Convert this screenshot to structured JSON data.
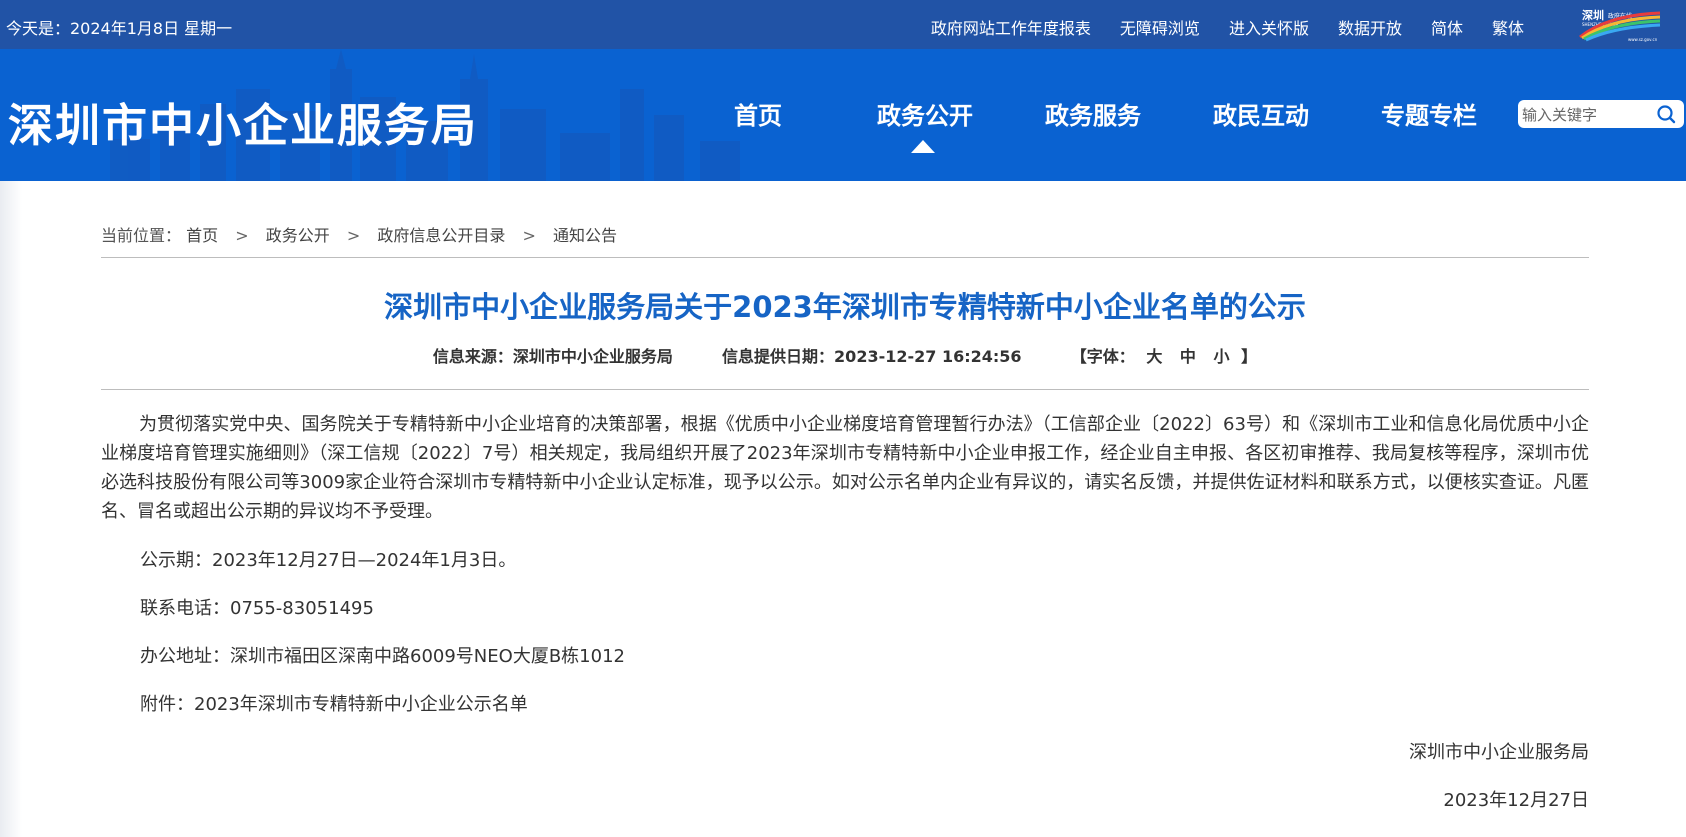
{
  "topbar": {
    "date": "今天是：2024年1月8日 星期一",
    "links": [
      "政府网站工作年度报表",
      "无障碍浏览",
      "进入关怀版",
      "数据开放",
      "简体",
      "繁体"
    ],
    "logo_text": "深圳 政府在线"
  },
  "header": {
    "site_title": "深圳市中小企业服务局",
    "nav": [
      "首页",
      "政务公开",
      "政务服务",
      "政民互动",
      "专题专栏"
    ],
    "active_nav": "政务公开",
    "search_placeholder": "输入关键字"
  },
  "breadcrumb": {
    "prefix": "当前位置：",
    "items": [
      "首页",
      "政务公开",
      "政府信息公开目录",
      "通知公告"
    ],
    "separator": ">"
  },
  "article": {
    "title": "深圳市中小企业服务局关于2023年深圳市专精特新中小企业名单的公示",
    "source": "信息来源：深圳市中小企业服务局",
    "date": "信息提供日期：2023-12-27 16:24:56",
    "font_label": "【字体：",
    "font_large": "大",
    "font_medium": "中",
    "font_small": "小",
    "font_close": "】",
    "paragraph": "为贯彻落实党中央、国务院关于专精特新中小企业培育的决策部署，根据《优质中小企业梯度培育管理暂行办法》（工信部企业〔2022〕63号）和《深圳市工业和信息化局优质中小企业梯度培育管理实施细则》（深工信规〔2022〕7号）相关规定，我局组织开展了2023年深圳市专精特新中小企业申报工作，经企业自主申报、各区初审推荐、我局复核等程序，深圳市优必选科技股份有限公司等3009家企业符合深圳市专精特新中小企业认定标准，现予以公示。如对公示名单内企业有异议的，请实名反馈，并提供佐证材料和联系方式，以便核实查证。凡匿名、冒名或超出公示期的异议均不予受理。",
    "period": "公示期：2023年12月27日—2024年1月3日。",
    "phone": "联系电话：0755-83051495",
    "address": "办公地址：深圳市福田区深南中路6009号NEO大厦B栋1012",
    "attachment_label": "附件：",
    "attachment": "2023年深圳市专精特新中小企业公示名单",
    "signature": "深圳市中小企业服务局",
    "sign_date": "2023年12月27日"
  },
  "colors": {
    "topbar_bg": "#2153a6",
    "header_bg": "#0a62d1",
    "title_blue": "#1664c5"
  }
}
